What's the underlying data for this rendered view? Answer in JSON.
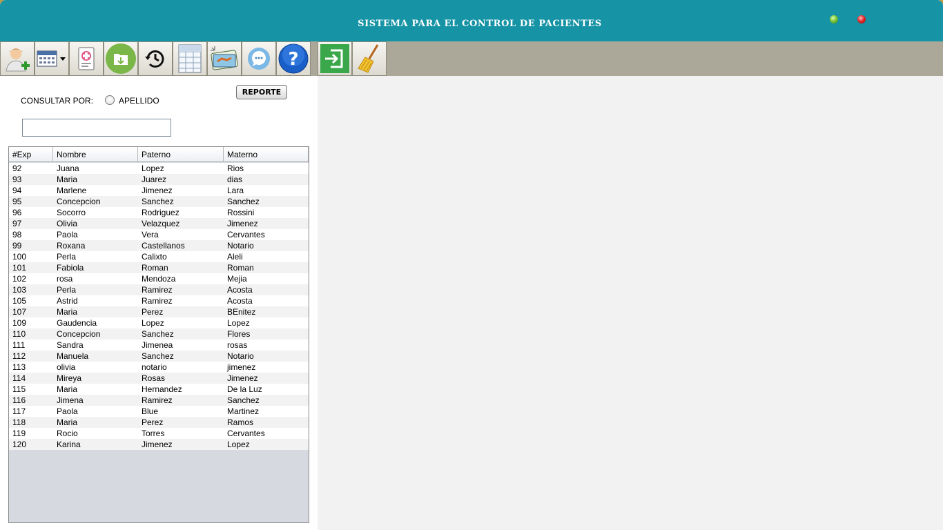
{
  "window": {
    "title": "SISTEMA PARA EL CONTROL DE PACIENTES"
  },
  "toolbar": {
    "buttons": [
      {
        "icon": "add-patient-icon"
      },
      {
        "icon": "calendar-dropdown-icon"
      },
      {
        "icon": "medical-record-icon"
      },
      {
        "icon": "download-folder-icon"
      },
      {
        "icon": "history-icon"
      },
      {
        "icon": "spreadsheet-icon"
      },
      {
        "icon": "payments-icon"
      },
      {
        "icon": "chat-icon"
      },
      {
        "icon": "help-icon"
      },
      {
        "icon": "exit-icon"
      },
      {
        "icon": "broom-icon"
      }
    ]
  },
  "search": {
    "consult_label": "CONSULTAR POR:",
    "radio_label": "APELLIDO",
    "value": "",
    "report_button": "REPORTE"
  },
  "table": {
    "columns": [
      "#Exp",
      "Nombre",
      "Paterno",
      "Materno"
    ],
    "rows": [
      [
        "92",
        "Juana",
        "Lopez",
        "Rios"
      ],
      [
        "93",
        "Maria",
        "Juarez",
        "dias"
      ],
      [
        "94",
        "Marlene",
        "Jimenez",
        "Lara"
      ],
      [
        "95",
        "Concepcion",
        "Sanchez",
        "Sanchez"
      ],
      [
        "96",
        "Socorro",
        "Rodriguez",
        "Rossini"
      ],
      [
        "97",
        "Olivia",
        "Velazquez",
        "Jimenez"
      ],
      [
        "98",
        "Paola",
        "Vera",
        "Cervantes"
      ],
      [
        "99",
        "Roxana",
        "Castellanos",
        "Notario"
      ],
      [
        "100",
        "Perla",
        "Calixto",
        "Aleli"
      ],
      [
        "101",
        "Fabiola",
        "Roman",
        "Roman"
      ],
      [
        "102",
        "rosa",
        "Mendoza",
        "Mejia"
      ],
      [
        "103",
        "Perla",
        "Ramirez",
        "Acosta"
      ],
      [
        "105",
        "Astrid",
        "Ramirez",
        "Acosta"
      ],
      [
        "107",
        "Maria",
        "Perez",
        "BEnitez"
      ],
      [
        "109",
        "Gaudencia",
        "Lopez",
        "Lopez"
      ],
      [
        "110",
        "Concepcion",
        "Sanchez",
        "Flores"
      ],
      [
        "111",
        "Sandra",
        "Jimenea",
        "rosas"
      ],
      [
        "112",
        "Manuela",
        "Sanchez",
        "Notario"
      ],
      [
        "113",
        "olivia",
        "notario",
        "jimenez"
      ],
      [
        "114",
        "Mireya",
        "Rosas",
        "Jimenez"
      ],
      [
        "115",
        "Maria",
        "Hernandez",
        "De la Luz"
      ],
      [
        "116",
        "Jimena",
        "Ramirez",
        "Sanchez"
      ],
      [
        "117",
        "Paola",
        "Blue",
        "Martinez"
      ],
      [
        "118",
        "Maria",
        "Perez",
        "Ramos"
      ],
      [
        "119",
        "Rocio",
        "Torres",
        "Cervantes"
      ],
      [
        "120",
        "Karina",
        "Jimenez",
        "Lopez"
      ]
    ]
  },
  "colors": {
    "titlebar": "#1693a5",
    "toolbar": "#aca899"
  }
}
